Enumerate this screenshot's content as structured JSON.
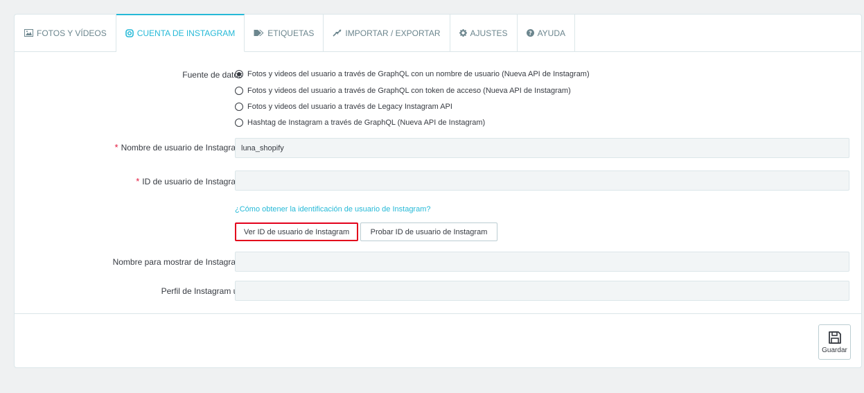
{
  "tabs": [
    {
      "label": "FOTOS Y VÍDEOS",
      "icon": "image-icon"
    },
    {
      "label": "CUENTA DE INSTAGRAM",
      "icon": "instagram-icon"
    },
    {
      "label": "ETIQUETAS",
      "icon": "tag-icon"
    },
    {
      "label": "IMPORTAR / EXPORTAR",
      "icon": "import-export-icon"
    },
    {
      "label": "AJUSTES",
      "icon": "gear-icon"
    },
    {
      "label": "AYUDA",
      "icon": "question-icon"
    }
  ],
  "active_tab": "CUENTA DE INSTAGRAM",
  "form": {
    "data_source_label": "Fuente de datos",
    "data_source_options": [
      {
        "label": "Fotos y videos del usuario a través de GraphQL con un nombre de usuario (Nueva API de Instagram)",
        "selected": true
      },
      {
        "label": "Fotos y videos del usuario a través de GraphQL con token de acceso (Nueva API de Instagram)",
        "selected": false
      },
      {
        "label": "Fotos y videos del usuario a través de Legacy Instagram API",
        "selected": false
      },
      {
        "label": "Hashtag de Instagram a través de GraphQL (Nueva API de Instagram)",
        "selected": false
      }
    ],
    "username_label": "Nombre de usuario de Instagram",
    "username_value": "luna_shopify",
    "user_id_label": "ID de usuario de Instagram",
    "user_id_value": "",
    "required_mark": "*",
    "help_link": "¿Cómo obtener la identificación de usuario de Instagram?",
    "view_id_button": "Ver ID de usuario de Instagram",
    "test_id_button": "Probar ID de usuario de Instagram",
    "display_name_label": "Nombre para mostrar de Instagram",
    "display_name_value": "",
    "profile_url_label": "Perfil de Instagram url",
    "profile_url_value": ""
  },
  "footer": {
    "save_label": "Guardar",
    "save_icon": "floppy-disk-icon"
  },
  "colors": {
    "accent": "#25b9d7",
    "required": "#e3173d",
    "highlight_border": "#e3001b"
  }
}
